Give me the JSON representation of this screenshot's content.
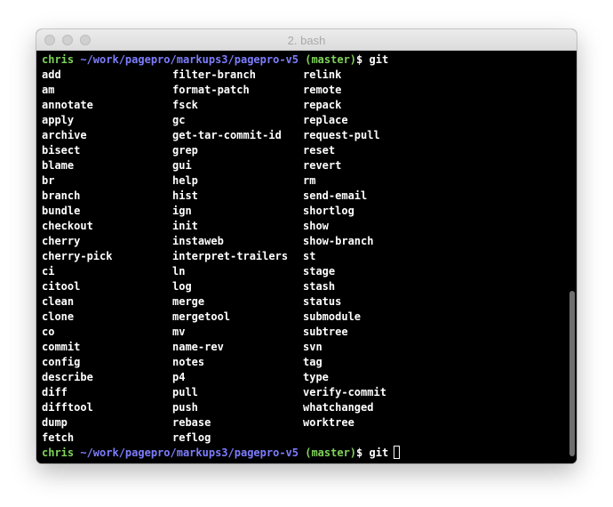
{
  "window": {
    "title": "2. bash"
  },
  "prompt": {
    "user": "chris",
    "path": "~/work/pagepro/markups3/pagepro-v5",
    "branch": "(master)",
    "symbol": "$"
  },
  "first_command": "git",
  "second_command": "git",
  "completions": {
    "col1": [
      "add",
      "am",
      "annotate",
      "apply",
      "archive",
      "bisect",
      "blame",
      "br",
      "branch",
      "bundle",
      "checkout",
      "cherry",
      "cherry-pick",
      "ci",
      "citool",
      "clean",
      "clone",
      "co",
      "commit",
      "config",
      "describe",
      "diff",
      "difftool",
      "dump",
      "fetch"
    ],
    "col2": [
      "filter-branch",
      "format-patch",
      "fsck",
      "gc",
      "get-tar-commit-id",
      "grep",
      "gui",
      "help",
      "hist",
      "ign",
      "init",
      "instaweb",
      "interpret-trailers",
      "ln",
      "log",
      "merge",
      "mergetool",
      "mv",
      "name-rev",
      "notes",
      "p4",
      "pull",
      "push",
      "rebase",
      "reflog"
    ],
    "col3": [
      "relink",
      "remote",
      "repack",
      "replace",
      "request-pull",
      "reset",
      "revert",
      "rm",
      "send-email",
      "shortlog",
      "show",
      "show-branch",
      "st",
      "stage",
      "stash",
      "status",
      "submodule",
      "subtree",
      "svn",
      "tag",
      "type",
      "verify-commit",
      "whatchanged",
      "worktree"
    ]
  },
  "colors": {
    "user": "#7fd35a",
    "path": "#7d7dff",
    "branch": "#7fd35a",
    "text": "#ffffff",
    "background": "#000000"
  }
}
